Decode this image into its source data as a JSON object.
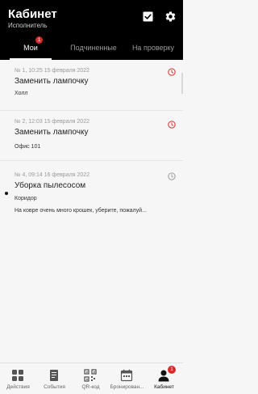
{
  "header": {
    "title": "Кабинет",
    "subtitle": "Исполнитель",
    "background": "#000000"
  },
  "tabs": [
    {
      "label": "Мои",
      "active": true,
      "badge": "1"
    },
    {
      "label": "Подчиненные",
      "active": false
    },
    {
      "label": "На проверку",
      "active": false
    }
  ],
  "requests": [
    {
      "meta": "№ 1, 10:25 15 февраля 2022",
      "title": "Заменить лампочку",
      "location": "Холл",
      "description": "",
      "status_icon": "clock-icon",
      "status_color": "#d62b2b",
      "unread": false
    },
    {
      "meta": "№ 2, 12:03 15 февраля 2022",
      "title": "Заменить лампочку",
      "location": "Офис 101",
      "description": "",
      "status_icon": "clock-icon",
      "status_color": "#d62b2b",
      "unread": false
    },
    {
      "meta": "№ 4, 09:14 16 февраля 2022",
      "title": "Уборка пылесосом",
      "location": "Коридор",
      "description": "На ковре очень много крошек, уберите, пожалуй...",
      "status_icon": "clock-icon",
      "status_color": "#9a9a9a",
      "unread": true
    }
  ],
  "bottom_nav": [
    {
      "label": "Действия",
      "icon": "grid-icon"
    },
    {
      "label": "События",
      "icon": "events-icon"
    },
    {
      "label": "QR-код",
      "icon": "qr-code-icon"
    },
    {
      "label": "Бронирован...",
      "icon": "calendar-icon"
    },
    {
      "label": "Кабинет",
      "icon": "profile-icon",
      "active": true,
      "badge": "1"
    }
  ],
  "colors": {
    "accent": "#d62b2b",
    "page_background": "#f6f6f6"
  }
}
